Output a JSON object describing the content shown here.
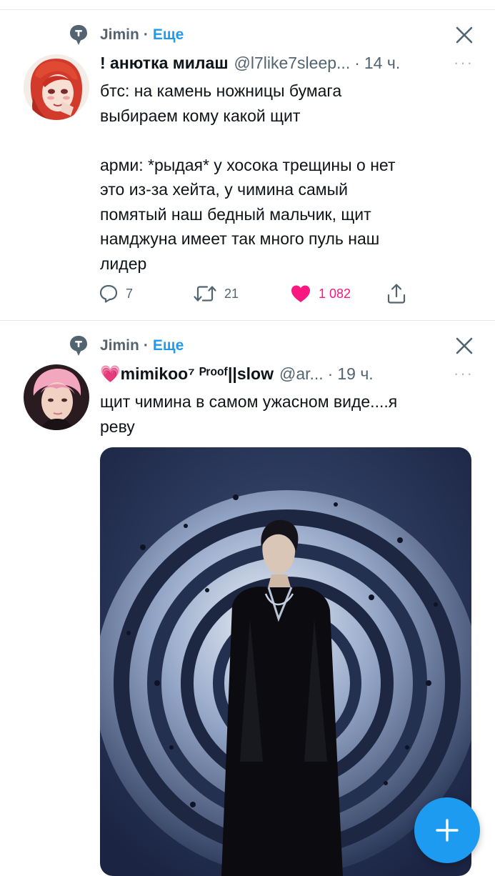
{
  "tweets": [
    {
      "context": {
        "name": "Jimin",
        "separator": "·",
        "more": "Еще"
      },
      "display_name": "! анютка милаш",
      "handle": "@l7like7sleep...",
      "separator": "·",
      "time": "14 ч.",
      "more_dots": "···",
      "text": "бтс: на камень ножницы бумага\nвыбираем кому какой щит\n\nарми: *рыдая* у хосока трещины о нет\nэто из-за хейта, у чимина самый\nпомятый наш бедный мальчик, щит\nнамджуна имеет так много пуль наш\nлидер",
      "replies": "7",
      "retweets": "21",
      "likes": "1 082",
      "avatar_icon": "redhead-anime-avatar"
    },
    {
      "context": {
        "name": "Jimin",
        "separator": "·",
        "more": "Еще"
      },
      "display_name": "💗mimikoo⁷ ᴾʳᵒᵒᶠ||slow",
      "handle": "@ar...",
      "separator": "·",
      "time": "19 ч.",
      "more_dots": "···",
      "text": "щит чимина в самом ужасном виде....я\nреву",
      "avatar_icon": "pink-hair-avatar",
      "media_icon": "photo-man-in-black-leather-with-shield"
    }
  ],
  "colors": {
    "accent": "#1d9bf0",
    "like": "#f91880",
    "secondary_text": "#536471"
  },
  "icons": [
    "pin-icon",
    "close-icon",
    "reply-icon",
    "retweet-icon",
    "heart-icon",
    "share-icon",
    "compose-plus-icon"
  ]
}
